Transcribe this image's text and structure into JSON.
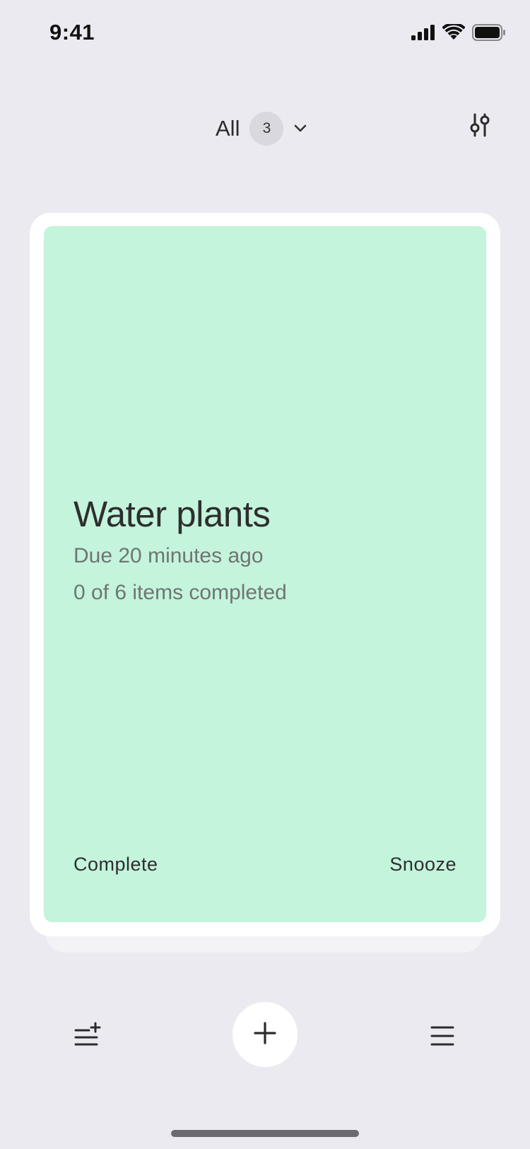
{
  "status_bar": {
    "time": "9:41"
  },
  "header": {
    "filter_label": "All",
    "count": "3"
  },
  "card": {
    "title": "Water plants",
    "due": "Due 20 minutes ago",
    "progress_text": "0 of 6 items completed",
    "complete_label": "Complete",
    "snooze_label": "Snooze",
    "color": "#c4f4dc"
  },
  "colors": {
    "background": "#ebeaf0",
    "card_border": "#ffffff",
    "text_primary": "#2e2e2e",
    "text_secondary": "#6f7672"
  },
  "icons": {
    "signal": "cellular-signal-icon",
    "wifi": "wifi-icon",
    "battery": "battery-icon",
    "chevron": "chevron-down-icon",
    "settings": "sliders-icon",
    "add_list": "add-list-icon",
    "add": "plus-icon",
    "menu": "hamburger-menu-icon"
  }
}
